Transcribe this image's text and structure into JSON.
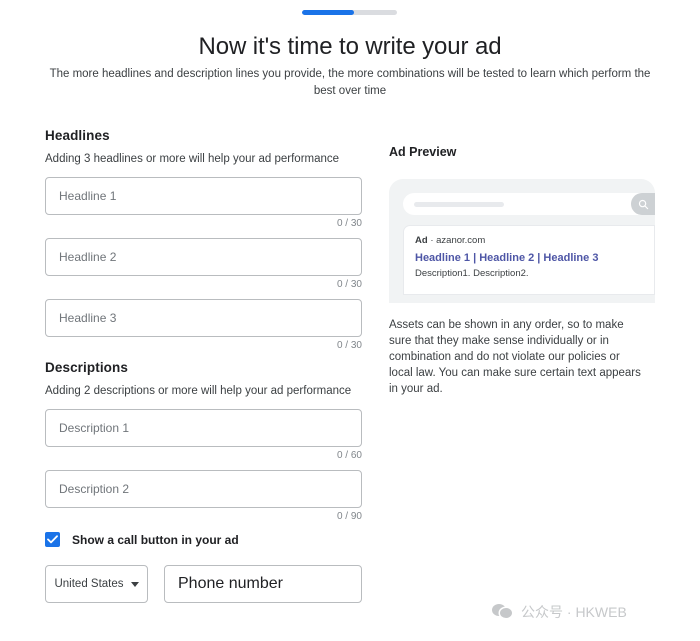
{
  "progress": {
    "percent": 55,
    "label": "step-progress"
  },
  "header": {
    "title": "Now it's time to write your ad",
    "subtitle": "The more headlines and description lines you provide, the more combinations will be tested to learn which perform the best over time"
  },
  "headlines": {
    "section_title": "Headlines",
    "hint": "Adding 3 headlines or more will help your ad performance",
    "fields": [
      {
        "placeholder": "Headline 1",
        "value": "",
        "counter": "0 / 30"
      },
      {
        "placeholder": "Headline 2",
        "value": "",
        "counter": "0 / 30"
      },
      {
        "placeholder": "Headline 3",
        "value": "",
        "counter": "0 / 30"
      }
    ]
  },
  "descriptions": {
    "section_title": "Descriptions",
    "hint": "Adding 2 descriptions or more will help your ad performance",
    "fields": [
      {
        "placeholder": "Description 1",
        "value": "",
        "counter": "0 / 60"
      },
      {
        "placeholder": "Description 2",
        "value": "",
        "counter": "0 / 90"
      }
    ]
  },
  "call_button": {
    "checkbox_label": "Show a call button in your ad",
    "checked": true,
    "country": "United States",
    "phone_placeholder": "Phone number",
    "phone_value": ""
  },
  "preview": {
    "title": "Ad Preview",
    "search_placeholder": "",
    "search_icon": "search-icon",
    "ad_label": "Ad",
    "separator": "·",
    "domain": "azanor.com",
    "headline": "Headline 1 | Headline 2 | Headline 3",
    "description": "Description1. Description2.",
    "disclaimer": "Assets can be shown in any order, so to make sure that they make sense individually or in combination and do not violate our policies or local law. You can make sure certain text appears in your ad."
  },
  "watermark": {
    "text": "公众号 · HKWEB"
  },
  "colors": {
    "accent": "#1a73e8",
    "progress_track": "#dadce0",
    "border": "#b9bcbf",
    "link": "#4e56a6",
    "muted_text": "#70757a",
    "phone_body": "#f1f3f4"
  }
}
